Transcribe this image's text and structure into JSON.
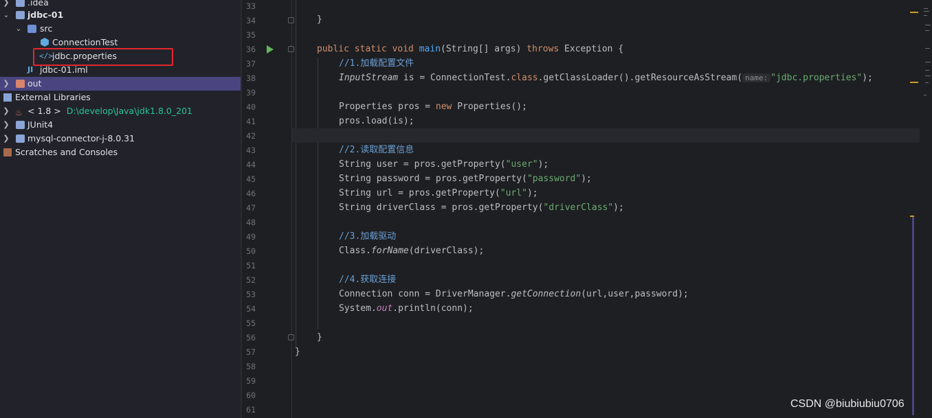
{
  "project_tree": {
    "items": [
      {
        "label": ".idea"
      },
      {
        "label": "jdbc-01"
      },
      {
        "label": "src"
      },
      {
        "label": "ConnectionTest"
      },
      {
        "label": "jdbc.properties"
      },
      {
        "label": "jdbc-01.iml"
      },
      {
        "label": "out"
      },
      {
        "label": "External Libraries"
      },
      {
        "label": "< 1.8 >",
        "path": "D:\\develop\\Java\\jdk1.8.0_201"
      },
      {
        "label": "JUnit4"
      },
      {
        "label": "mysql-connector-j-8.0.31"
      },
      {
        "label": "Scratches and Consoles"
      }
    ]
  },
  "editor": {
    "line_numbers": [
      "33",
      "34",
      "35",
      "36",
      "37",
      "38",
      "39",
      "40",
      "41",
      "42",
      "43",
      "44",
      "45",
      "46",
      "47",
      "48",
      "49",
      "50",
      "51",
      "52",
      "53",
      "54",
      "55",
      "56",
      "57",
      "58",
      "59",
      "60",
      "61"
    ],
    "tokens": {
      "close_brace": "}",
      "public_static_void": "public static void ",
      "main": "main",
      "main_params": "(String[] args) ",
      "throws": "throws",
      "exception": " Exception {",
      "comment1": "//1.加载配置文件",
      "inputstream": "InputStream",
      "is_eq": " is = ConnectionTest.",
      "class_kw": "class",
      "getclassloader": ".getClassLoader().getResourceAsStream(",
      "hint_name": "name:",
      "jdbc_props_str": "\"jdbc.properties\"",
      "close_paren_semi": ");",
      "properties_pros": "Properties pros = ",
      "new_kw": "new",
      "new_properties": " Properties();",
      "pros_load": "pros.load(is);",
      "comment2": "//2.读取配置信息",
      "string_user": "String user = pros.getProperty(",
      "str_user": "\"user\"",
      "string_password": "String password = pros.getProperty(",
      "str_password": "\"password\"",
      "string_url": "String url = pros.getProperty(",
      "str_url": "\"url\"",
      "string_driverclass": "String driverClass = pros.getProperty(",
      "str_driverclass": "\"driverClass\"",
      "comment3": "//3.加载驱动",
      "class_prefix": "Class.",
      "forname": "forName",
      "forname_args": "(driverClass);",
      "comment4": "//4.获取连接",
      "connection_conn": "Connection conn = DriverManager.",
      "getconnection": "getConnection",
      "getconnection_args": "(url,user,password);",
      "system_prefix": "System.",
      "out": "out",
      "println": ".println(conn);"
    }
  },
  "watermark": "CSDN @biubiubiu0706",
  "colors": {
    "selection": "#4a4580",
    "highlight_box": "#e5262e",
    "keyword": "#cf8e6d",
    "string": "#6aab73",
    "comment": "#6a9fd4",
    "path": "#27c49a"
  }
}
